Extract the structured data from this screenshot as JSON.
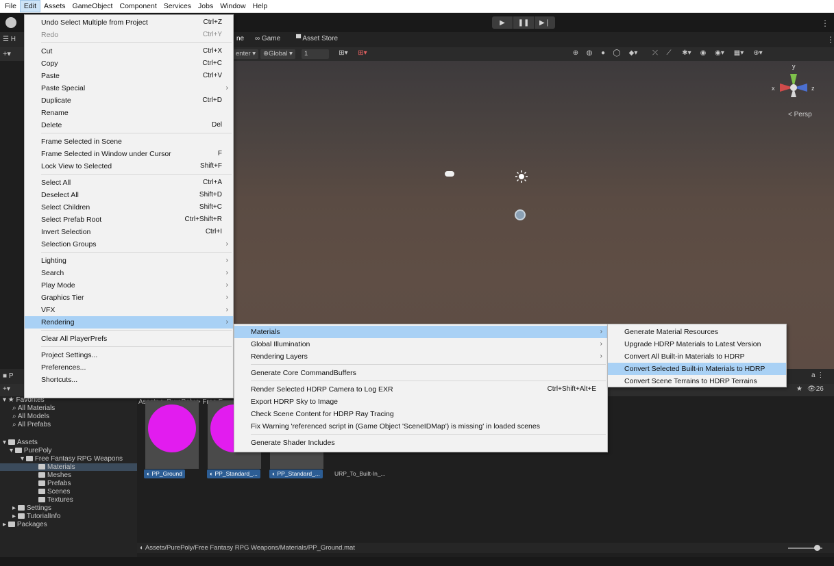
{
  "menubar": {
    "items": [
      "File",
      "Edit",
      "Assets",
      "GameObject",
      "Component",
      "Services",
      "Jobs",
      "Window",
      "Help"
    ],
    "active": "Edit"
  },
  "edit_menu": {
    "items": [
      {
        "label": "Undo Select Multiple from Project",
        "shortcut": "Ctrl+Z"
      },
      {
        "label": "Redo",
        "shortcut": "Ctrl+Y",
        "disabled": true
      },
      {
        "label": "Cut",
        "shortcut": "Ctrl+X"
      },
      {
        "label": "Copy",
        "shortcut": "Ctrl+C"
      },
      {
        "label": "Paste",
        "shortcut": "Ctrl+V"
      },
      {
        "label": "Paste Special",
        "shortcut": ""
      },
      {
        "label": "Duplicate",
        "shortcut": "Ctrl+D"
      },
      {
        "label": "Rename",
        "shortcut": ""
      },
      {
        "label": "Delete",
        "shortcut": "Del"
      },
      {
        "label": "Frame Selected in Scene",
        "shortcut": ""
      },
      {
        "label": "Frame Selected in Window under Cursor",
        "shortcut": "F"
      },
      {
        "label": "Lock View to Selected",
        "shortcut": "Shift+F"
      },
      {
        "label": "Select All",
        "shortcut": "Ctrl+A"
      },
      {
        "label": "Deselect All",
        "shortcut": "Shift+D"
      },
      {
        "label": "Select Children",
        "shortcut": "Shift+C"
      },
      {
        "label": "Select Prefab Root",
        "shortcut": "Ctrl+Shift+R"
      },
      {
        "label": "Invert Selection",
        "shortcut": "Ctrl+I"
      },
      {
        "label": "Selection Groups",
        "shortcut": ""
      },
      {
        "label": "Lighting",
        "shortcut": ""
      },
      {
        "label": "Search",
        "shortcut": ""
      },
      {
        "label": "Play Mode",
        "shortcut": ""
      },
      {
        "label": "Graphics Tier",
        "shortcut": ""
      },
      {
        "label": "VFX",
        "shortcut": ""
      },
      {
        "label": "Rendering",
        "shortcut": ""
      },
      {
        "label": "Clear All PlayerPrefs",
        "shortcut": ""
      },
      {
        "label": "Project Settings...",
        "shortcut": ""
      },
      {
        "label": "Preferences...",
        "shortcut": ""
      },
      {
        "label": "Shortcuts...",
        "shortcut": ""
      }
    ]
  },
  "rendering_menu": {
    "items": [
      {
        "label": "Materials",
        "shortcut": ""
      },
      {
        "label": "Global Illumination",
        "shortcut": ""
      },
      {
        "label": "Rendering Layers",
        "shortcut": ""
      },
      {
        "label": "Generate Core CommandBuffers",
        "shortcut": ""
      },
      {
        "label": "Render Selected HDRP Camera to Log EXR",
        "shortcut": "Ctrl+Shift+Alt+E"
      },
      {
        "label": "Export HDRP Sky to Image",
        "shortcut": ""
      },
      {
        "label": "Check Scene Content for HDRP Ray Tracing",
        "shortcut": ""
      },
      {
        "label": "Fix Warning 'referenced script in (Game Object 'SceneIDMap') is missing' in loaded scenes",
        "shortcut": ""
      },
      {
        "label": "Generate Shader Includes",
        "shortcut": ""
      }
    ]
  },
  "materials_menu": {
    "items": [
      {
        "label": "Generate Material Resources"
      },
      {
        "label": "Upgrade HDRP Materials to Latest Version"
      },
      {
        "label": "Convert All Built-in Materials to HDRP"
      },
      {
        "label": "Convert Selected Built-in Materials to HDRP"
      },
      {
        "label": "Convert Scene Terrains to HDRP Terrains"
      }
    ]
  },
  "editor": {
    "tabs": [
      "ne",
      "Game",
      "Asset Store"
    ],
    "scene_toolbar": {
      "pivot": "enter",
      "space": "Global",
      "grid_value": "1"
    },
    "persp_label": "< Persp",
    "gizmo_axes": [
      "y",
      "x",
      "z"
    ],
    "project": {
      "breadcrumb": "Assets > PurePoly > Free F",
      "count": "26",
      "tree": [
        {
          "label": "Favorites"
        },
        {
          "label": "All Materials"
        },
        {
          "label": "All Models"
        },
        {
          "label": "All Prefabs"
        },
        {
          "label": "Assets"
        },
        {
          "label": "PurePoly"
        },
        {
          "label": "Free Fantasy RPG Weapons"
        },
        {
          "label": "Materials"
        },
        {
          "label": "Meshes"
        },
        {
          "label": "Prefabs"
        },
        {
          "label": "Scenes"
        },
        {
          "label": "Textures"
        },
        {
          "label": "Settings"
        },
        {
          "label": "TutorialInfo"
        },
        {
          "label": "Packages"
        }
      ],
      "assets": [
        {
          "label": "PP_Ground"
        },
        {
          "label": "PP_Standard_..."
        },
        {
          "label": "PP_Standard_..."
        },
        {
          "label": "URP_To_Built-In_..."
        }
      ],
      "status_path": "Assets/PurePoly/Free Fantasy RPG Weapons/Materials/PP_Ground.mat"
    }
  },
  "colors": {
    "menu_highlight": "#a9d1f5",
    "material_preview": "#e21cef",
    "selected_asset_label": "#2c5d94"
  }
}
